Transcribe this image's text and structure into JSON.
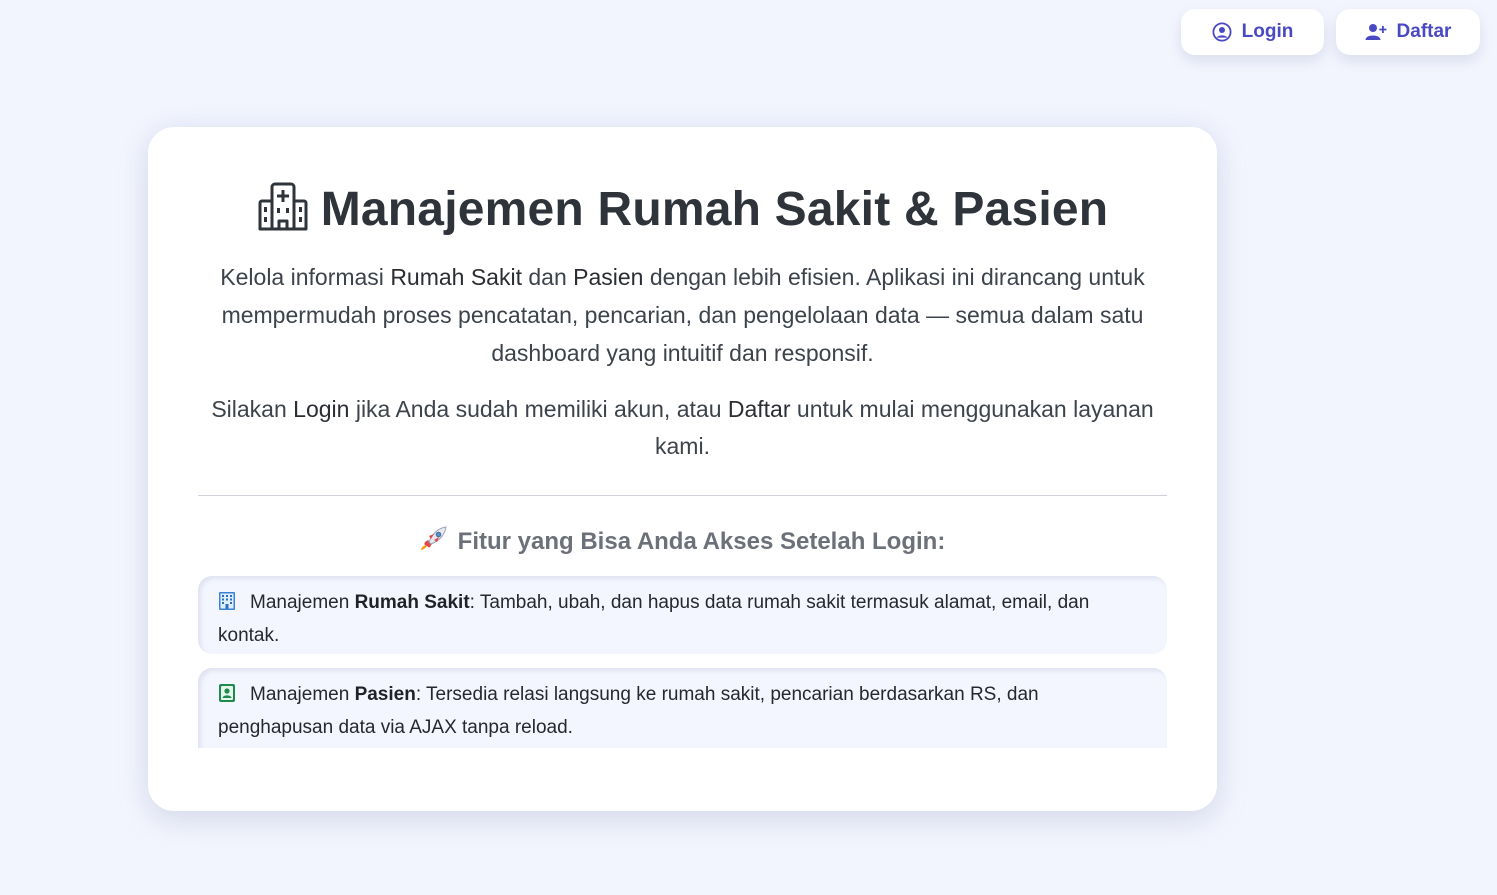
{
  "topbar": {
    "login_label": "Login",
    "login_icon": "user-circle-icon",
    "daftar_label": "Daftar",
    "daftar_icon": "user-plus-icon",
    "accent_color": "#4a49c4"
  },
  "hero": {
    "title_icon": "hospital-icon",
    "title": "Manajemen Rumah Sakit & Pasien",
    "intro": {
      "t1": "Kelola informasi ",
      "b1": "Rumah Sakit",
      "t2": " dan ",
      "b2": "Pasien",
      "t3": " dengan lebih efisien. Aplikasi ini dirancang untuk mempermudah proses pencatatan, pencarian, dan pengelolaan data — semua dalam satu dashboard yang intuitif dan responsif."
    },
    "cta": {
      "t1": "Silakan ",
      "b1": "Login",
      "t2": " jika Anda sudah memiliki akun, atau ",
      "b2": "Daftar",
      "t3": " untuk mulai menggunakan layanan kami."
    }
  },
  "features": {
    "heading_icon": "rocket-icon",
    "heading": "Fitur yang Bisa Anda Akses Setelah Login:",
    "items": [
      {
        "icon": "building-icon",
        "prefix": "Manajemen ",
        "bold": "Rumah Sakit",
        "text": ": Tambah, ubah, dan hapus data rumah sakit termasuk alamat, email, dan kontak."
      },
      {
        "icon": "id-badge-icon",
        "prefix": "Manajemen ",
        "bold": "Pasien",
        "text": ": Tersedia relasi langsung ke rumah sakit, pencarian berdasarkan RS, dan penghapusan data via AJAX tanpa reload."
      }
    ]
  }
}
